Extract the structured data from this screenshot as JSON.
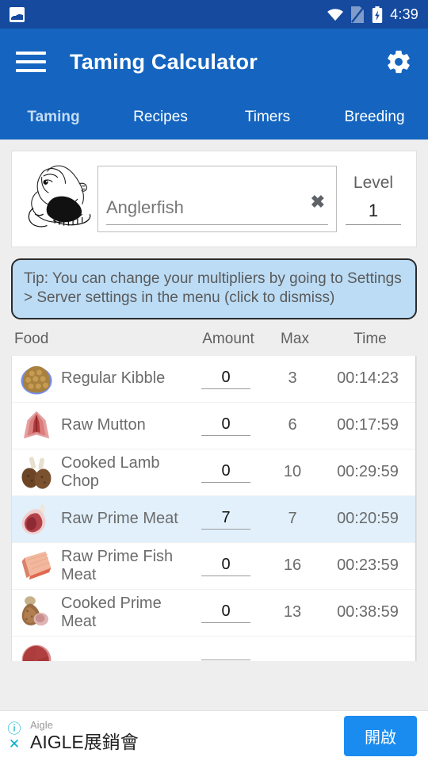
{
  "statusbar": {
    "notification_icon": "image-icon",
    "wifi_icon": "wifi-icon",
    "sim_icon": "no-sim-icon",
    "battery_icon": "battery-charging-icon",
    "clock": "4:39"
  },
  "appbar": {
    "menu_icon": "hamburger-menu-icon",
    "title": "Taming Calculator",
    "settings_icon": "gear-icon"
  },
  "tabs": [
    {
      "label": "Taming",
      "active": true
    },
    {
      "label": "Recipes",
      "active": false
    },
    {
      "label": "Timers",
      "active": false
    },
    {
      "label": "Breeding",
      "active": false
    }
  ],
  "search_card": {
    "creature_icon": "anglerfish-illustration",
    "creature_name": "Anglerfish",
    "clear_icon": "✖",
    "level_label": "Level",
    "level_value": "1"
  },
  "tip": {
    "text": "Tip: You can change your multipliers by going to Settings > Server settings in the menu (click to dismiss)"
  },
  "table": {
    "headers": {
      "food": "Food",
      "amount": "Amount",
      "max": "Max",
      "time": "Time"
    },
    "rows": [
      {
        "icon": "kibble-icon",
        "name": "Regular Kibble",
        "amount": "0",
        "max": "3",
        "time": "00:14:23",
        "selected": false
      },
      {
        "icon": "raw-mutton-icon",
        "name": "Raw Mutton",
        "amount": "0",
        "max": "6",
        "time": "00:17:59",
        "selected": false
      },
      {
        "icon": "cooked-lamb-chop-icon",
        "name": "Cooked Lamb Chop",
        "amount": "0",
        "max": "10",
        "time": "00:29:59",
        "selected": false
      },
      {
        "icon": "raw-prime-meat-icon",
        "name": "Raw Prime Meat",
        "amount": "7",
        "max": "7",
        "time": "00:20:59",
        "selected": true
      },
      {
        "icon": "raw-prime-fish-icon",
        "name": "Raw Prime Fish Meat",
        "amount": "0",
        "max": "16",
        "time": "00:23:59",
        "selected": false
      },
      {
        "icon": "cooked-prime-meat-icon",
        "name": "Cooked Prime Meat",
        "amount": "0",
        "max": "13",
        "time": "00:38:59",
        "selected": false
      },
      {
        "icon": "raw-meat-icon",
        "name": "",
        "amount": "",
        "max": "",
        "time": "",
        "selected": false
      }
    ]
  },
  "ad": {
    "info_icon": "ⓘ",
    "close_icon": "✕",
    "advertiser": "Aigle",
    "headline": "AIGLE展銷會",
    "cta_label": "開啟"
  },
  "colors": {
    "statusbar": "#154a9e",
    "appbar": "#1565c0",
    "tab_active": "#c5dcf2",
    "tip_bg": "#bcdcf5",
    "row_selected": "#e1f0fb",
    "ad_cta": "#1a8cf0",
    "ad_icon": "#00aecd"
  }
}
